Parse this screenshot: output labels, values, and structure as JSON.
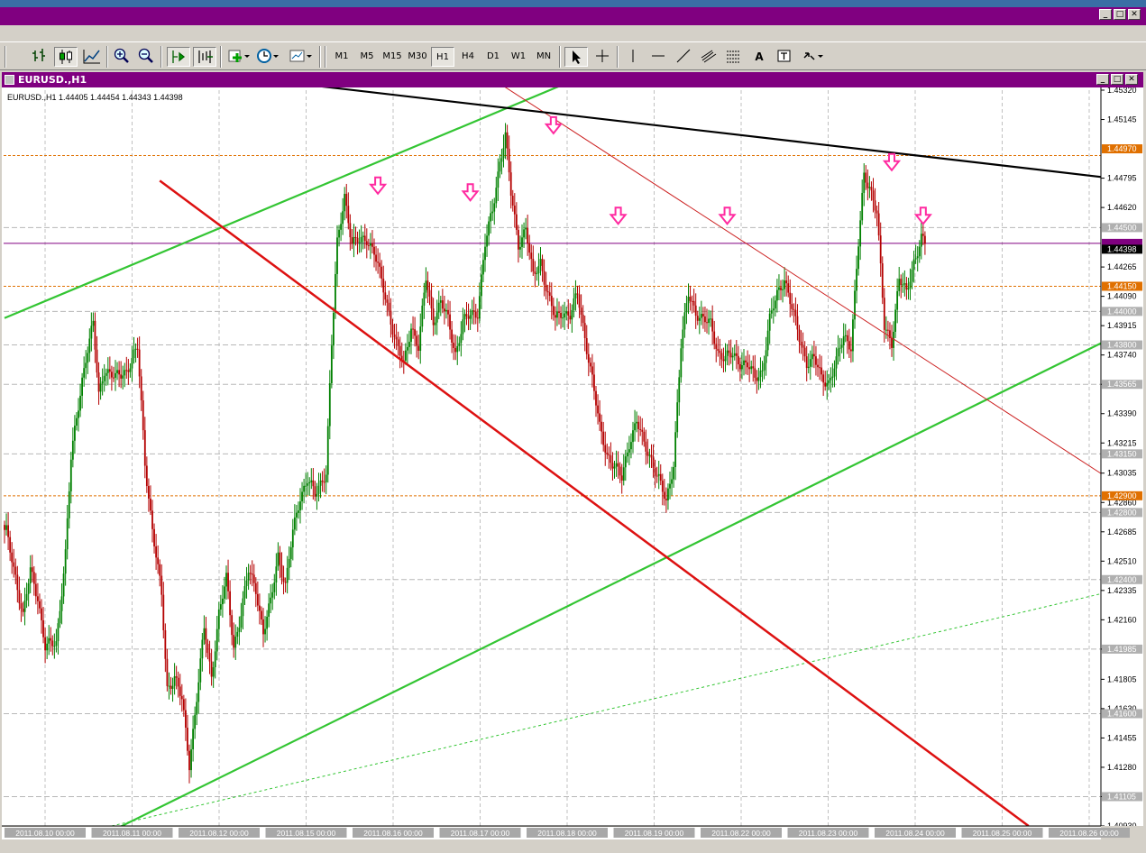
{
  "window": {
    "min_label": "_",
    "max_label": "□",
    "close_label": "✕"
  },
  "toolbar": {
    "timeframes": [
      "M1",
      "M5",
      "M15",
      "M30",
      "H1",
      "H4",
      "D1",
      "W1",
      "MN"
    ],
    "active_timeframe": "H1",
    "text_tool_label": "A",
    "icons": [
      "bar-chart-icon",
      "candlestick-icon",
      "line-chart-icon",
      "zoom-in-icon",
      "zoom-out-icon",
      "autoscroll-icon",
      "chart-shift-icon",
      "indicators-icon",
      "periods-icon",
      "templates-icon",
      "cursor-icon",
      "crosshair-icon",
      "vertical-line-icon",
      "horizontal-line-icon",
      "trendline-icon",
      "fibonacci-icon",
      "channel-icon",
      "text-label-icon",
      "arrows-icon"
    ]
  },
  "chart_window": {
    "title": "EURUSD.,H1"
  },
  "chart_data": {
    "type": "candlestick",
    "symbol_info": "EURUSD.,H1  1.44405 1.44454 1.44343 1.44398",
    "colors": {
      "bull": "#008000",
      "bear": "#b40000",
      "trend_green": "#33c533",
      "trend_red": "#dd1111",
      "resistance": "#000000",
      "level_orange": "#e07000",
      "level_purple": "#800080",
      "arrow": "#ff2aa0",
      "grid": "#c0c0c0"
    },
    "ylim": [
      1.4093,
      1.4532
    ],
    "price_ticks": [
      "1.45320",
      "1.45145",
      "1.44795",
      "1.44620",
      "1.44265",
      "1.44090",
      "1.43915",
      "1.43740",
      "1.43565",
      "1.43390",
      "1.43215",
      "1.43035",
      "1.42860",
      "1.42685",
      "1.42510",
      "1.42335",
      "1.42160",
      "1.41985",
      "1.41805",
      "1.41630",
      "1.41455",
      "1.41280",
      "1.41105",
      "1.40930"
    ],
    "gray_levels": [
      "1.44500",
      "1.44000",
      "1.43800",
      "1.43565",
      "1.43150",
      "1.42800",
      "1.42400",
      "1.41985",
      "1.41600",
      "1.41105"
    ],
    "orange_levels": [
      "1.44930",
      "1.44150",
      "1.42900"
    ],
    "current_price": "1.44398",
    "orange_labels": [
      "1.44970",
      "1.44150",
      "1.42900"
    ],
    "time_labels": [
      "2011.08.10 00:00",
      "2011.08.11 00:00",
      "2011.08.12 00:00",
      "2011.08.15 00:00",
      "2011.08.16 00:00",
      "2011.08.17 00:00",
      "2011.08.18 00:00",
      "2011.08.19 00:00",
      "2011.08.22 00:00",
      "2011.08.23 00:00",
      "2011.08.24 00:00",
      "2011.08.25 00:00",
      "2011.08.26 00:00"
    ],
    "keypoints": [
      [
        1,
        1.4268
      ],
      [
        6,
        1.4242
      ],
      [
        10,
        1.4218
      ],
      [
        14,
        1.4245
      ],
      [
        18,
        1.423
      ],
      [
        22,
        1.42
      ],
      [
        28,
        1.4202
      ],
      [
        33,
        1.4256
      ],
      [
        36,
        1.4312
      ],
      [
        42,
        1.436
      ],
      [
        45,
        1.4378
      ],
      [
        48,
        1.4392
      ],
      [
        51,
        1.435
      ],
      [
        54,
        1.4366
      ],
      [
        60,
        1.436
      ],
      [
        66,
        1.4365
      ],
      [
        72,
        1.4378
      ],
      [
        76,
        1.431
      ],
      [
        80,
        1.427
      ],
      [
        85,
        1.423
      ],
      [
        88,
        1.4175
      ],
      [
        92,
        1.4182
      ],
      [
        96,
        1.4168
      ],
      [
        100,
        1.413
      ],
      [
        104,
        1.417
      ],
      [
        108,
        1.421
      ],
      [
        112,
        1.4182
      ],
      [
        116,
        1.422
      ],
      [
        120,
        1.424
      ],
      [
        124,
        1.42
      ],
      [
        128,
        1.422
      ],
      [
        132,
        1.4245
      ],
      [
        136,
        1.4235
      ],
      [
        140,
        1.4208
      ],
      [
        144,
        1.4226
      ],
      [
        148,
        1.4255
      ],
      [
        152,
        1.4236
      ],
      [
        156,
        1.4268
      ],
      [
        160,
        1.429
      ],
      [
        164,
        1.43
      ],
      [
        168,
        1.429
      ],
      [
        174,
        1.4305
      ],
      [
        177,
        1.438
      ],
      [
        180,
        1.444
      ],
      [
        184,
        1.447
      ],
      [
        188,
        1.444
      ],
      [
        192,
        1.4442
      ],
      [
        196,
        1.4444
      ],
      [
        200,
        1.4435
      ],
      [
        204,
        1.4418
      ],
      [
        208,
        1.44
      ],
      [
        212,
        1.438
      ],
      [
        216,
        1.4368
      ],
      [
        220,
        1.4392
      ],
      [
        224,
        1.4378
      ],
      [
        228,
        1.442
      ],
      [
        232,
        1.4395
      ],
      [
        236,
        1.4405
      ],
      [
        240,
        1.4395
      ],
      [
        244,
        1.4375
      ],
      [
        248,
        1.4393
      ],
      [
        252,
        1.4398
      ],
      [
        256,
        1.44
      ],
      [
        260,
        1.444
      ],
      [
        264,
        1.446
      ],
      [
        268,
        1.449
      ],
      [
        271,
        1.4505
      ],
      [
        274,
        1.447
      ],
      [
        278,
        1.444
      ],
      [
        282,
        1.445
      ],
      [
        286,
        1.442
      ],
      [
        290,
        1.443
      ],
      [
        294,
        1.441
      ],
      [
        298,
        1.4395
      ],
      [
        302,
        1.44
      ],
      [
        306,
        1.4398
      ],
      [
        310,
        1.441
      ],
      [
        314,
        1.4385
      ],
      [
        318,
        1.436
      ],
      [
        322,
        1.433
      ],
      [
        326,
        1.4315
      ],
      [
        330,
        1.4308
      ],
      [
        334,
        1.43
      ],
      [
        338,
        1.4322
      ],
      [
        342,
        1.4335
      ],
      [
        346,
        1.432
      ],
      [
        350,
        1.4312
      ],
      [
        354,
        1.43
      ],
      [
        358,
        1.4285
      ],
      [
        362,
        1.431
      ],
      [
        366,
        1.438
      ],
      [
        370,
        1.441
      ],
      [
        374,
        1.44
      ],
      [
        378,
        1.4395
      ],
      [
        382,
        1.4392
      ],
      [
        386,
        1.4376
      ],
      [
        390,
        1.4372
      ],
      [
        394,
        1.4374
      ],
      [
        398,
        1.437
      ],
      [
        402,
        1.4368
      ],
      [
        406,
        1.436
      ],
      [
        410,
        1.4365
      ],
      [
        414,
        1.4395
      ],
      [
        418,
        1.441
      ],
      [
        422,
        1.442
      ],
      [
        426,
        1.4402
      ],
      [
        430,
        1.4384
      ],
      [
        434,
        1.437
      ],
      [
        438,
        1.4372
      ],
      [
        442,
        1.436
      ],
      [
        446,
        1.4358
      ],
      [
        450,
        1.437
      ],
      [
        454,
        1.4385
      ],
      [
        458,
        1.438
      ],
      [
        462,
        1.444
      ],
      [
        465,
        1.448
      ],
      [
        468,
        1.4475
      ],
      [
        472,
        1.446
      ],
      [
        476,
        1.439
      ],
      [
        480,
        1.4382
      ],
      [
        484,
        1.442
      ],
      [
        488,
        1.441
      ],
      [
        492,
        1.443
      ],
      [
        496,
        1.4444
      ],
      [
        498,
        1.444
      ]
    ],
    "trendlines": [
      {
        "name": "upper-green-channel-line",
        "color": "#33c533",
        "width": 2.2,
        "dash": "",
        "p1": [
          0,
          1.4396
        ],
        "p2": [
          334,
          1.455
        ]
      },
      {
        "name": "lower-green-channel-line",
        "color": "#33c533",
        "width": 2.2,
        "dash": "",
        "p1": [
          58,
          1.409
        ],
        "p2": [
          595,
          1.4382
        ]
      },
      {
        "name": "dotted-green-line",
        "color": "#33c533",
        "width": 1,
        "dash": "3,3",
        "p1": [
          58,
          1.4093
        ],
        "p2": [
          595,
          1.4232
        ]
      },
      {
        "name": "thick-red-line",
        "color": "#dd1111",
        "width": 2.5,
        "dash": "",
        "p1": [
          84,
          1.4478
        ],
        "p2": [
          554,
          1.4093
        ]
      },
      {
        "name": "thin-red-line",
        "color": "#cc2222",
        "width": 1,
        "dash": "",
        "p1": [
          258,
          1.4543
        ],
        "p2": [
          595,
          1.4302
        ]
      },
      {
        "name": "black-resistance-line",
        "color": "#000000",
        "width": 2.2,
        "dash": "",
        "p1": [
          103,
          1.4543
        ],
        "p2": [
          595,
          1.448
        ]
      }
    ],
    "arrows": [
      [
        202,
        1.4474
      ],
      [
        252,
        1.447
      ],
      [
        297,
        1.451
      ],
      [
        332,
        1.4456
      ],
      [
        391,
        1.4456
      ],
      [
        480,
        1.4488
      ],
      [
        497,
        1.4456
      ]
    ],
    "x_max": 595
  }
}
